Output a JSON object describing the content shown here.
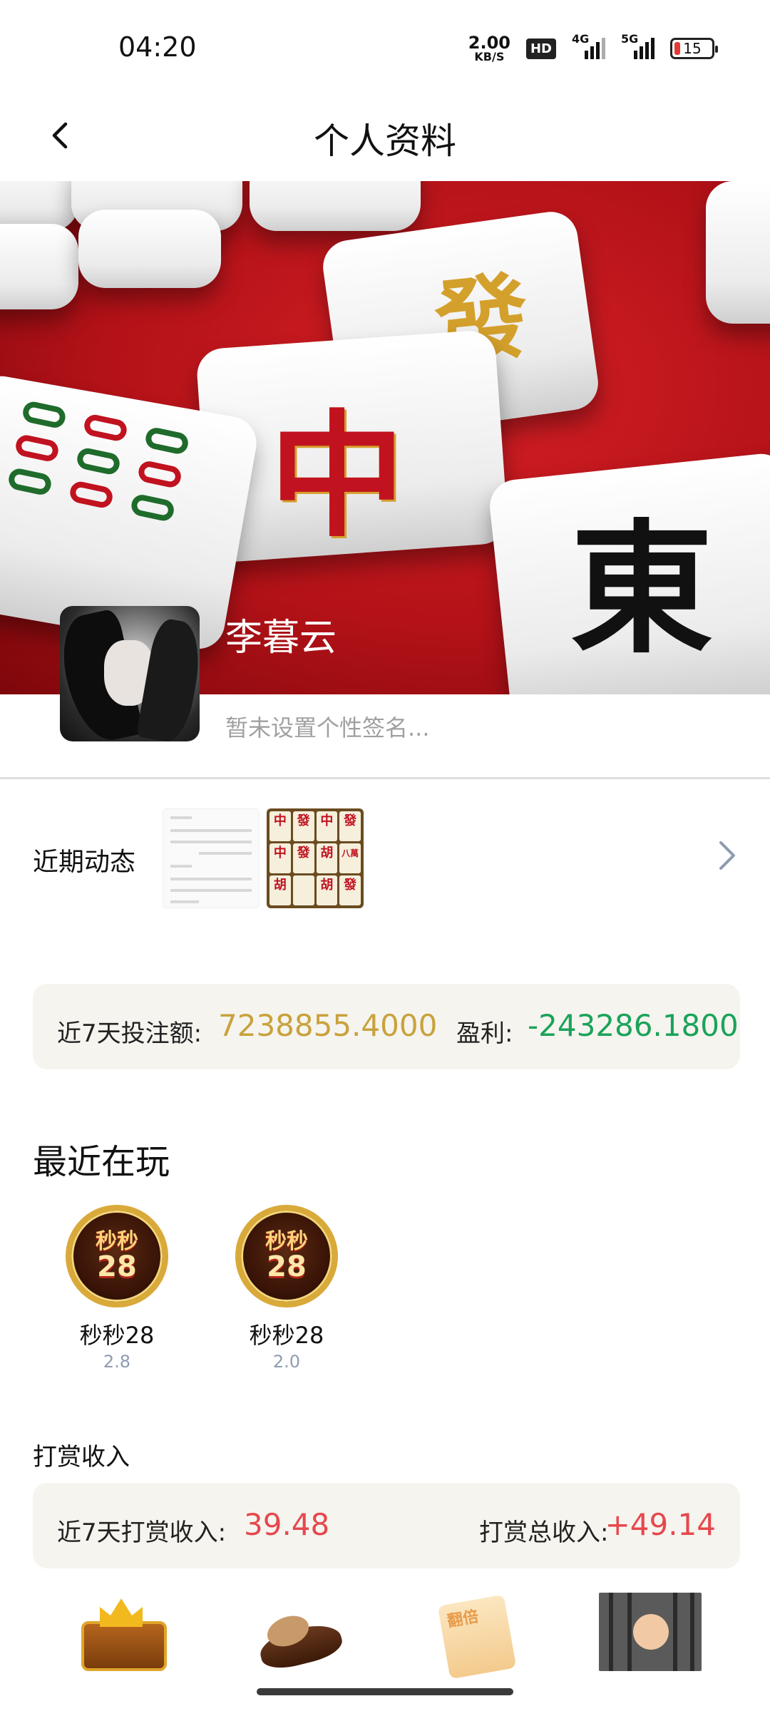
{
  "status_bar": {
    "time": "04:20",
    "net_speed_value": "2.00",
    "net_speed_unit": "KB/S",
    "hd_label": "HD",
    "signal1_label": "4G",
    "signal2_label": "5G",
    "battery": "15"
  },
  "header": {
    "back_icon": "chevron-left-icon",
    "title": "个人资料"
  },
  "profile": {
    "username": "李暮云",
    "bio_placeholder": "暂未设置个性签名..."
  },
  "activity": {
    "label": "近期动态",
    "thumb2_tiles": [
      "中",
      "發",
      "中",
      "發",
      "中",
      "發",
      "胡",
      "八萬",
      "胡",
      "",
      "胡",
      "發"
    ]
  },
  "stats": {
    "bet_label": "近7天投注额:",
    "bet_value": "7238855.4000",
    "profit_label": "盈利:",
    "profit_value": "-243286.1800",
    "colors": {
      "bet": "#c8a23c",
      "profit": "#1aa35a"
    }
  },
  "recent_games": {
    "title": "最近在玩",
    "items": [
      {
        "icon_top": "秒秒",
        "icon_bottom": "28",
        "name": "秒秒28",
        "version": "2.8"
      },
      {
        "icon_top": "秒秒",
        "icon_bottom": "28",
        "name": "秒秒28",
        "version": "2.0"
      }
    ]
  },
  "rewards": {
    "title": "打赏收入",
    "week_label": "近7天打赏收入:",
    "week_value": "39.48",
    "total_label": "打赏总收入:",
    "total_value": "+49.14",
    "value_color": "#e5484d"
  },
  "gifts": {
    "items": [
      {
        "icon": "treasure-chest-icon"
      },
      {
        "icon": "seashell-icon"
      },
      {
        "icon": "double-card-icon",
        "label": "翻倍"
      },
      {
        "icon": "jail-icon"
      }
    ]
  }
}
